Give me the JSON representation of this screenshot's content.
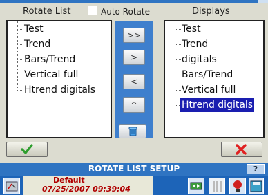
{
  "header": {
    "left_title": "Rotate List",
    "auto_rotate_label": "Auto Rotate",
    "auto_rotate_checked": false,
    "right_title": "Displays"
  },
  "rotate_list": {
    "items": [
      "Test",
      "Trend",
      "Bars/Trend",
      "Vertical full",
      "Htrend digitals"
    ]
  },
  "displays_list": {
    "items": [
      "Test",
      "Trend",
      "digitals",
      "Bars/Trend",
      "Vertical full",
      "Htrend digitals"
    ],
    "selected_index": 5
  },
  "transfer_buttons": {
    "add_all": ">>",
    "add": ">",
    "remove": "<",
    "move_up": "^"
  },
  "icons": {
    "delete": "trash-icon",
    "ok": "checkmark-icon",
    "cancel": "x-icon"
  },
  "titlebar": {
    "title": "ROTATE LIST SETUP",
    "help_label": "?"
  },
  "status": {
    "profile": "Default",
    "datetime": "07/25/2007 09:39:04"
  },
  "colors": {
    "accent_blue": "#2f74c2",
    "selection": "#1a1eb0",
    "ok_green": "#2e9e2e",
    "cancel_red": "#e02020"
  }
}
